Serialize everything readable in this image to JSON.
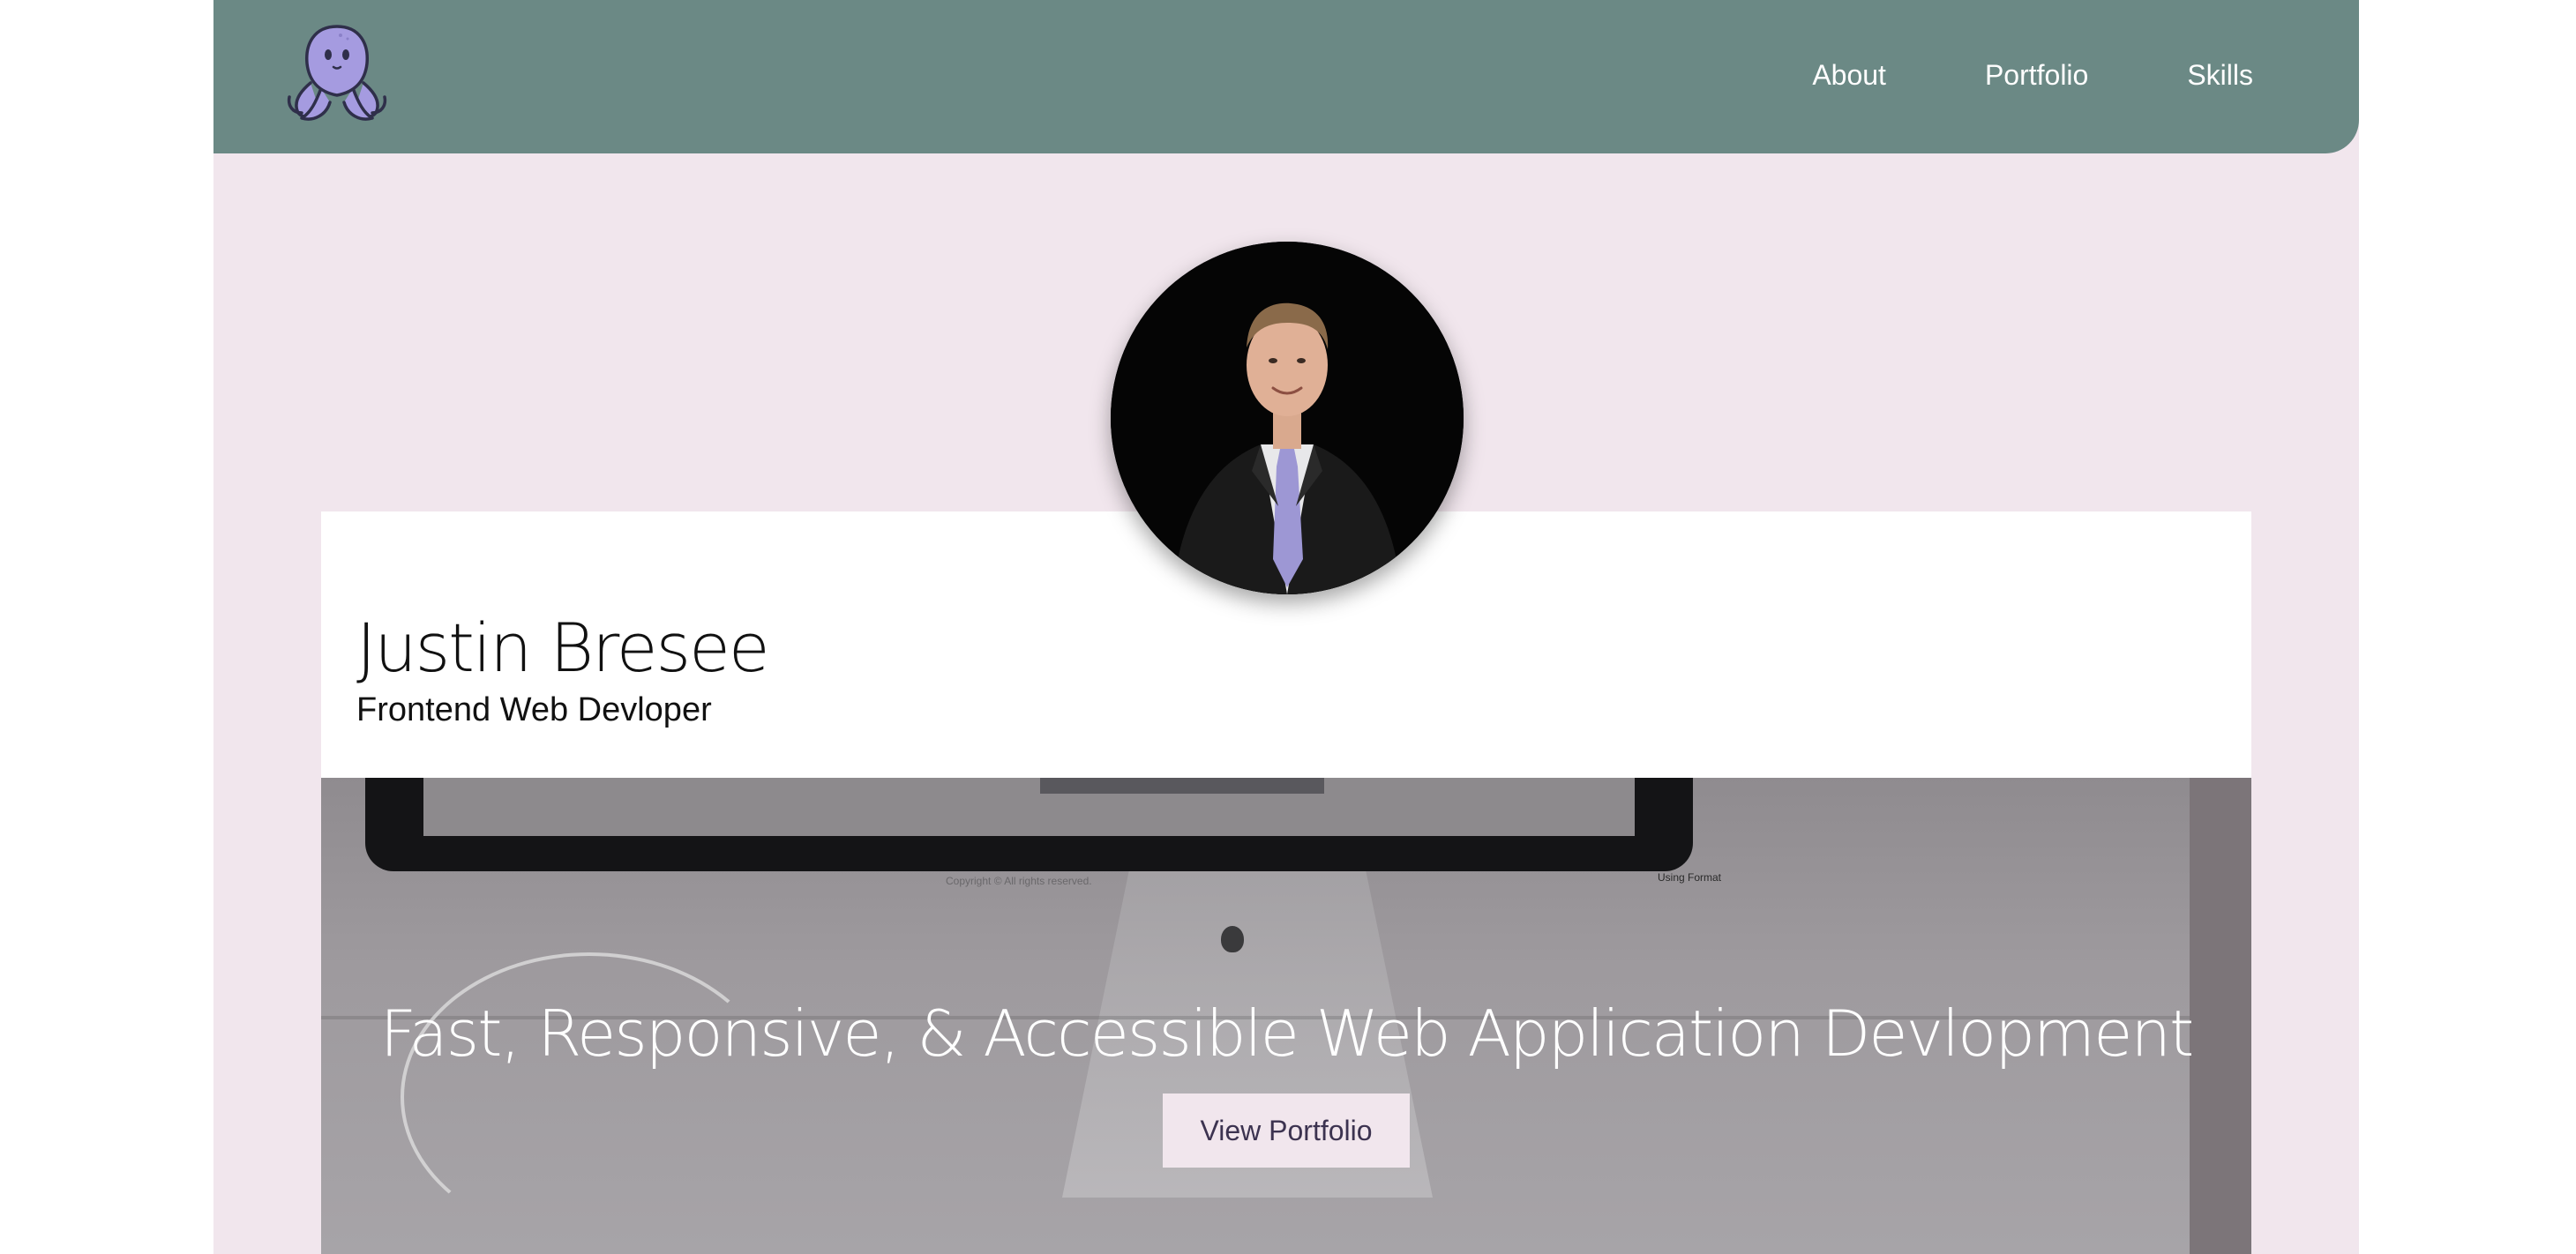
{
  "header": {
    "logo_icon": "octopus-logo-icon",
    "nav": [
      {
        "label": "About"
      },
      {
        "label": "Portfolio"
      },
      {
        "label": "Skills"
      }
    ]
  },
  "profile": {
    "name": "Justin Bresee",
    "role": "Frontend Web Devloper",
    "avatar_icon": "profile-photo"
  },
  "hero": {
    "title": "Fast, Responsive, & Accessible Web Application Devlopment",
    "button_label": "View Portfolio",
    "screen_copyright": "Copyright © All rights reserved.",
    "screen_credit": "Using Format"
  },
  "colors": {
    "header_bg": "#6b8985",
    "page_bg": "#f1e6ed",
    "octopus": "#a59be0",
    "button_text": "#3c3350"
  }
}
